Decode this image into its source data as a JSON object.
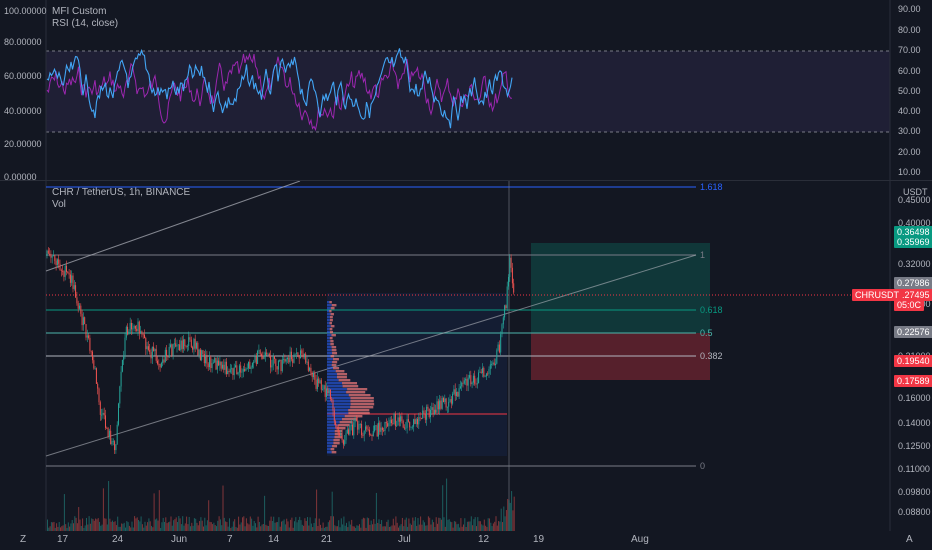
{
  "rsi_pane": {
    "title_line1": "MFI Custom",
    "title_line2": "RSI (14, close)",
    "left_ticks": [
      "100.00000",
      "80.00000",
      "60.00000",
      "40.00000",
      "20.00000",
      "0.00000"
    ],
    "right_ticks": [
      "90.00",
      "80.00",
      "70.00",
      "60.00",
      "50.00",
      "40.00",
      "30.00",
      "20.00",
      "10.00"
    ]
  },
  "price_pane": {
    "title_line1": "CHR / TetherUS, 1h, BINANCE",
    "title_line2": "Vol",
    "currency": "USDT",
    "right_ticks": [
      "0.45000",
      "0.40000",
      "0.32000",
      "0.28000",
      "0.24000",
      "0.21000",
      "0.18000",
      "0.16000",
      "0.14000",
      "0.12500",
      "0.11000",
      "0.09800",
      "0.08800"
    ],
    "fib_labels": [
      "1.618",
      "1",
      "0.618",
      "0.5",
      "0.382",
      "0"
    ],
    "price_tags": [
      {
        "label": "0.36498",
        "color": "#089981"
      },
      {
        "label": "0.35969",
        "color": "#089981"
      },
      {
        "label": "0.27986",
        "color": "#787b86"
      },
      {
        "label": "0.27495",
        "color": "#f23645"
      },
      {
        "label": "05:0C",
        "color": "#f23645"
      },
      {
        "label": "0.22576",
        "color": "#787b86"
      },
      {
        "label": "0.19540",
        "color": "#f23645"
      },
      {
        "label": "0.17589",
        "color": "#f23645"
      }
    ],
    "symbol_tag": "CHRUSDT"
  },
  "time_axis": {
    "labels": [
      "17",
      "24",
      "Jun",
      "7",
      "14",
      "21",
      "Jul",
      "12",
      "19",
      "Aug"
    ],
    "left_icon": "Z",
    "right_icon": "A"
  },
  "chart_data": {
    "type": "line",
    "title": "CHR / TetherUS, 1h, BINANCE",
    "symbol": "CHRUSDT",
    "x": [
      "17",
      "24",
      "Jun",
      "7",
      "14",
      "21",
      "Jul",
      "12"
    ],
    "series": [
      {
        "name": "CHR / TetherUS",
        "values": [
          0.33,
          0.115,
          0.21,
          0.19,
          0.185,
          0.13,
          0.135,
          0.33
        ]
      }
    ],
    "fibonacci_levels": {
      "1.618": 0.47,
      "1": 0.34,
      "0.618": 0.25,
      "0.5": 0.225,
      "0.382": 0.195,
      "0": 0.11
    },
    "rsi": {
      "overbought": 70,
      "oversold": 30
    },
    "colors": {
      "up": "#26a69a",
      "down": "#ef5350",
      "rsi": "#42a5f5",
      "mfi": "#9c27b0",
      "fib": "#2962ff"
    }
  }
}
